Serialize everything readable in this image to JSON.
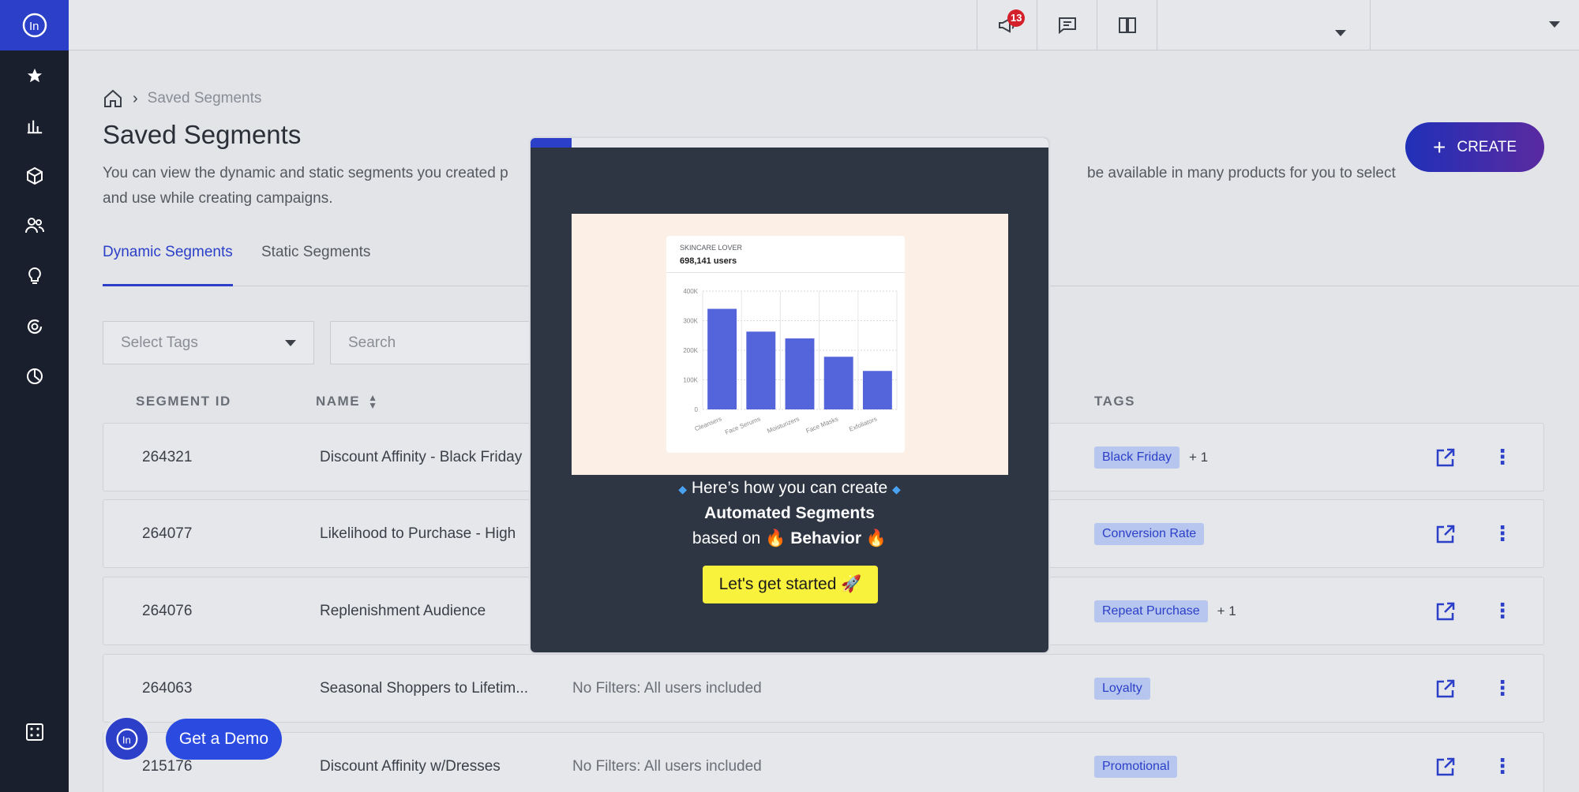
{
  "topbar": {
    "notification_count": "13"
  },
  "breadcrumb": {
    "current": "Saved Segments"
  },
  "page": {
    "title": "Saved Segments",
    "description_line1": "You can view the dynamic and static segments you created p",
    "description_line1_right": "be available in many products for you to select",
    "description_line2": "and use while creating campaigns.",
    "create_label": "CREATE"
  },
  "tabs": [
    {
      "label": "Dynamic Segments",
      "active": true
    },
    {
      "label": "Static Segments",
      "active": false
    }
  ],
  "filters": {
    "tags_placeholder": "Select Tags",
    "search_placeholder": "Search"
  },
  "table": {
    "headers": {
      "id": "SEGMENT ID",
      "name": "NAME",
      "tags": "TAGS"
    },
    "rows": [
      {
        "id": "264321",
        "name": "Discount Affinity - Black Friday",
        "filter": "",
        "tag": "Black Friday",
        "extra": "+ 1"
      },
      {
        "id": "264077",
        "name": "Likelihood to Purchase - High",
        "filter": "",
        "tag": "Conversion Rate",
        "extra": ""
      },
      {
        "id": "264076",
        "name": "Replenishment Audience",
        "filter": "",
        "tag": "Repeat Purchase",
        "extra": "+ 1"
      },
      {
        "id": "264063",
        "name": "Seasonal Shoppers to Lifetim...",
        "filter": "No Filters: All users included",
        "tag": "Loyalty",
        "extra": ""
      },
      {
        "id": "215176",
        "name": "Discount Affinity w/Dresses",
        "filter": "No Filters: All users included",
        "tag": "Promotional",
        "extra": ""
      }
    ]
  },
  "modal": {
    "progress": 0.08,
    "card_title": "SKINCARE LOVER",
    "card_users": "698,141 users",
    "line1": "Here’s how you can create",
    "line2": "Automated Segments",
    "line3_prefix": "based on",
    "line3_bold": "Behavior",
    "cta": "Let's get started 🚀"
  },
  "chart_data": {
    "type": "bar",
    "title": "SKINCARE LOVER",
    "subtitle": "698,141 users",
    "categories": [
      "Cleansers",
      "Face Serums",
      "Moisturizers",
      "Face Masks",
      "Exfoliators"
    ],
    "values": [
      340000,
      263000,
      240000,
      178000,
      130000
    ],
    "ylim": [
      0,
      400000
    ],
    "yticks": [
      "0",
      "100K",
      "200K",
      "300K",
      "400K"
    ],
    "bar_color": "#5465dc"
  },
  "widgets": {
    "demo_label": "Get a Demo"
  },
  "colors": {
    "sidebar": "#1a1f2e",
    "accent": "#2b3fc8",
    "cta": "#f9f23c",
    "modal_bg": "#2e3543"
  }
}
